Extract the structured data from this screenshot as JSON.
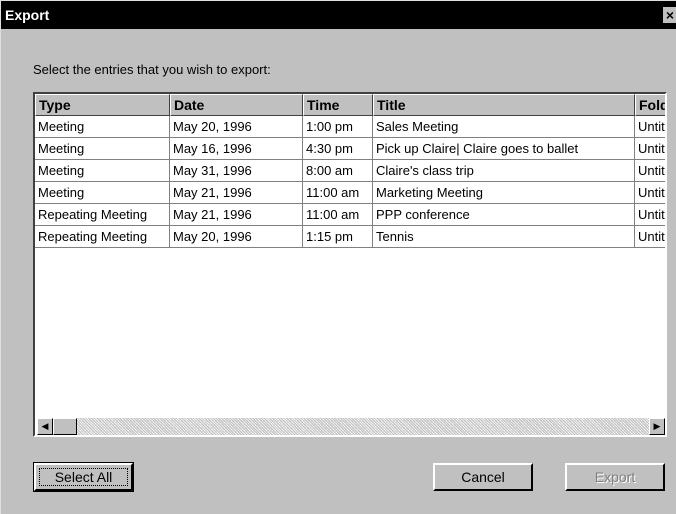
{
  "window": {
    "title": "Export",
    "close_symbol": "×"
  },
  "instructions": "Select the entries that you wish to export:",
  "table": {
    "columns": [
      "Type",
      "Date",
      "Time",
      "Title",
      "Folder"
    ],
    "rows": [
      [
        "Meeting",
        "May 20, 1996",
        "1:00 pm",
        "Sales Meeting",
        "Untitled"
      ],
      [
        "Meeting",
        "May 16, 1996",
        "4:30 pm",
        "Pick up Claire| Claire goes to ballet",
        "Untitled"
      ],
      [
        "Meeting",
        "May 31, 1996",
        "8:00 am",
        "Claire's class trip",
        "Untitled"
      ],
      [
        "Meeting",
        "May 21, 1996",
        "11:00 am",
        "Marketing Meeting",
        "Untitled"
      ],
      [
        "Repeating Meeting",
        "May 21, 1996",
        "11:00 am",
        "PPP conference",
        "Untitled"
      ],
      [
        "Repeating Meeting",
        "May 20, 1996",
        "1:15 pm",
        "Tennis",
        "Untitled"
      ]
    ]
  },
  "scrollbar": {
    "left_arrow": "◀",
    "right_arrow": "▶"
  },
  "buttons": {
    "select_all": "Select All",
    "cancel": "Cancel",
    "export": "Export"
  }
}
